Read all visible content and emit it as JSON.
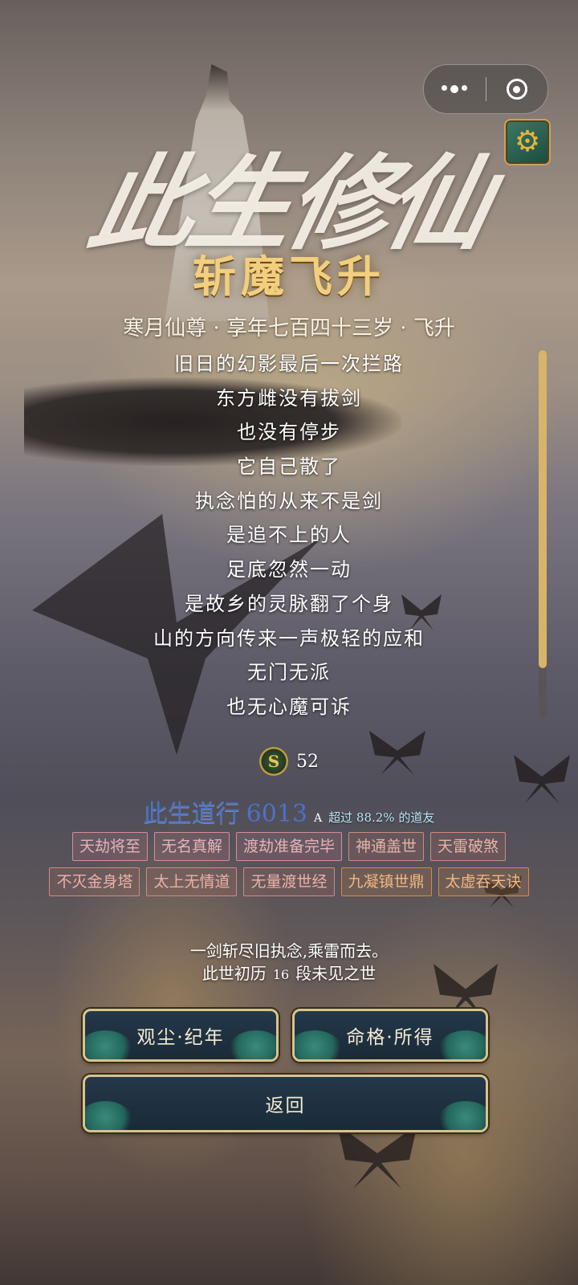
{
  "capsule": {
    "more_icon": "more-dots-icon",
    "close_icon": "target-circle-icon"
  },
  "settings_icon": "gear-icon",
  "title": {
    "logo": "此生修仙",
    "ending": "斩魔飞升"
  },
  "subtitle": "寒月仙尊 · 享年七百四十三岁 · 飞升",
  "poem": [
    "旧日的幻影最后一次拦路",
    "东方雌没有拔剑",
    "也没有停步",
    "它自己散了",
    "执念怕的从来不是剑",
    "是追不上的人",
    "足底忽然一动",
    "是故乡的灵脉翻了个身",
    "山的方向传来一声极轻的应和",
    "无门无派",
    "也无心魔可诉"
  ],
  "currency": {
    "icon": "spirit-coin-icon",
    "glyph": "S",
    "value": "52"
  },
  "score": {
    "label": "此生道行",
    "value": "6013",
    "grade": "A",
    "beat": "超过 88.2% 的道友"
  },
  "tags": [
    {
      "text": "天劫将至",
      "style": "pink"
    },
    {
      "text": "无名真解",
      "style": "pink"
    },
    {
      "text": "渡劫准备完毕",
      "style": "pink"
    },
    {
      "text": "神通盖世",
      "style": "rose"
    },
    {
      "text": "天雷破煞",
      "style": "rose"
    },
    {
      "text": "不灭金身塔",
      "style": "rose"
    },
    {
      "text": "太上无情道",
      "style": "rose"
    },
    {
      "text": "无量渡世经",
      "style": "rose"
    },
    {
      "text": "九凝镇世鼎",
      "style": "orange"
    },
    {
      "text": "太虚吞天诀",
      "style": "orange"
    }
  ],
  "description": {
    "line1": "一剑斩尽旧执念,乘雷而去。",
    "line2_pre": "此世初历",
    "line2_num": "16",
    "line2_post": "段未见之世"
  },
  "buttons": {
    "chronicle": "观尘·纪年",
    "destiny": "命格·所得",
    "back": "返回"
  },
  "colors": {
    "gold": "#f2cf7e",
    "score_blue": "#4a72c8",
    "button_bg": "#1a2a38",
    "button_border": "#d7c38e"
  }
}
